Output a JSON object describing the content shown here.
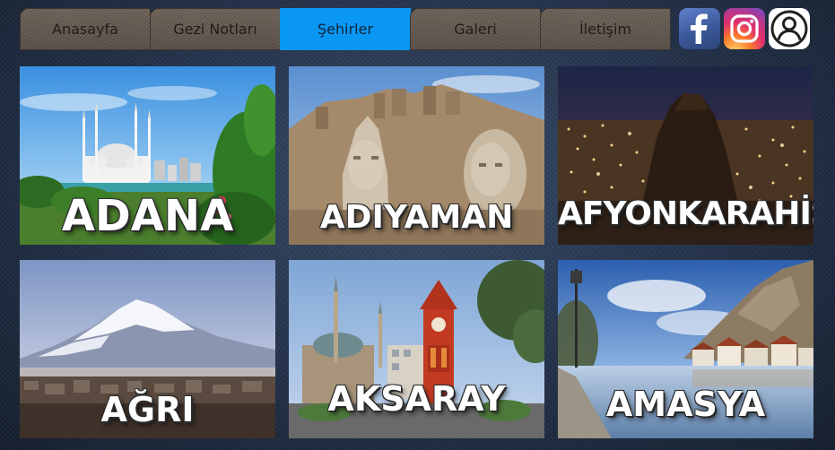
{
  "nav": {
    "tabs": [
      {
        "label": "Anasayfa",
        "active": false
      },
      {
        "label": "Gezi Notları",
        "active": false
      },
      {
        "label": "Şehirler",
        "active": true
      },
      {
        "label": "Galeri",
        "active": false
      },
      {
        "label": "İletişim",
        "active": false
      }
    ]
  },
  "social": {
    "icons": [
      "facebook-icon",
      "instagram-icon",
      "user-account-icon"
    ]
  },
  "cities": [
    {
      "name": "ADANA",
      "scene": "mosque-with-minarets-and-greenery"
    },
    {
      "name": "ADIYAMAN",
      "scene": "stone-head-statues-on-mountain"
    },
    {
      "name": "AFYONKARAHİSAR",
      "scene": "night-city-lights-with-rock-castle"
    },
    {
      "name": "AĞRI",
      "scene": "snowy-mountain-over-city"
    },
    {
      "name": "AKSARAY",
      "scene": "clock-tower-and-mosque"
    },
    {
      "name": "AMASYA",
      "scene": "riverside-houses-under-cliff"
    }
  ],
  "colors": {
    "active_tab": "#0a97f3",
    "tab": "#6a5f56",
    "background": "#233044"
  }
}
